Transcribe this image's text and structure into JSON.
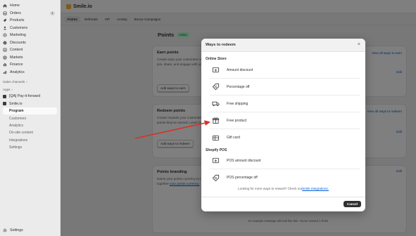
{
  "sidebar": {
    "nav": [
      {
        "label": "Home",
        "icon": "home-icon"
      },
      {
        "label": "Orders",
        "icon": "orders-icon",
        "badge": "1"
      },
      {
        "label": "Products",
        "icon": "products-icon"
      },
      {
        "label": "Customers",
        "icon": "customers-icon"
      },
      {
        "label": "Marketing",
        "icon": "marketing-icon"
      },
      {
        "label": "Discounts",
        "icon": "discounts-icon"
      },
      {
        "label": "Content",
        "icon": "content-icon"
      },
      {
        "label": "Markets",
        "icon": "markets-icon"
      },
      {
        "label": "Finance",
        "icon": "finance-icon"
      },
      {
        "label": "Analytics",
        "icon": "analytics-icon"
      }
    ],
    "sales_channels": "Sales channels",
    "apps": "Apps",
    "app_items": [
      "[QA] Pay-it-forward",
      "Smile.io"
    ],
    "sub_items": [
      "Program",
      "Customers",
      "Analytics",
      "On-site content",
      "Integrations",
      "Settings"
    ],
    "settings": "Settings"
  },
  "topbar": {
    "title": "Smile.io"
  },
  "tabs": [
    "Points",
    "Referrals",
    "VIP",
    "Activity",
    "Bonus Campaigns"
  ],
  "page": {
    "title": "Points",
    "status": "Active",
    "earn": {
      "title": "Earn points",
      "desc": "Create ways your customers can earn points when they join, share, and engage with your brand. Learn more about",
      "button": "Add ways to earn",
      "link": "View all ways to earn",
      "edit": "Edit"
    },
    "redeem": {
      "title": "Redeem points",
      "desc": "Create rewards your customers can redeem with the points they've earned. Learn more about",
      "desc_link": "customers rede",
      "button": "Add ways to redeem",
      "link": "View all ways to redeem",
      "edit": "Edit"
    },
    "branding": {
      "title": "Points branding",
      "desc": "Name your points currency to match your brand. We've put together",
      "desc_link": "your points currency.",
      "edit": "Edit",
      "example": "An example message will look like this: You've earned 1 Point"
    }
  },
  "modal": {
    "title": "Ways to redeem",
    "close": "×",
    "online_store": "Online Store",
    "online_options": [
      {
        "label": "Amount discount",
        "icon": "amount-discount-icon"
      },
      {
        "label": "Percentage off",
        "icon": "percentage-off-icon"
      },
      {
        "label": "Free shipping",
        "icon": "free-shipping-icon"
      },
      {
        "label": "Free product",
        "icon": "free-product-icon"
      },
      {
        "label": "Gift card",
        "icon": "gift-card-icon"
      }
    ],
    "pos": "Shopify POS",
    "pos_options": [
      {
        "label": "POS amount discount",
        "icon": "pos-amount-discount-icon"
      },
      {
        "label": "POS percentage off",
        "icon": "pos-percentage-off-icon"
      }
    ],
    "more_text": "Looking for more ways to reward? Check out",
    "more_link": "Smile integrations.",
    "cancel": "Cancel"
  },
  "colors": {
    "accent": "#005bd3",
    "annotation_arrow": "#d93025",
    "active_badge": "#b4fed2"
  }
}
